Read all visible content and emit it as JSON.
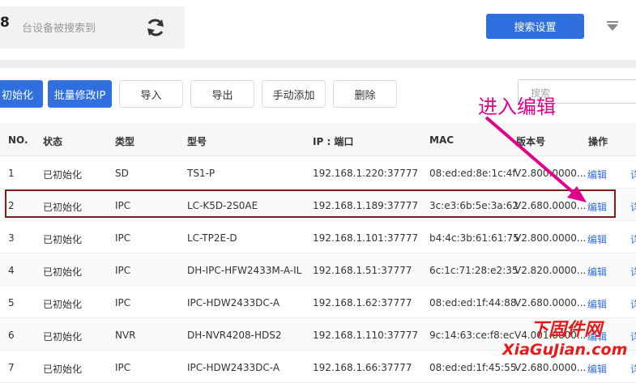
{
  "header": {
    "device_count": "8",
    "device_count_label": "台设备被搜索到",
    "search_settings_label": "搜索设置"
  },
  "toolbar": {
    "init_label": "初始化",
    "batch_modify_ip_label": "批量修改IP",
    "import_label": "导入",
    "export_label": "导出",
    "manual_add_label": "手动添加",
    "delete_label": "删除",
    "search_placeholder": "搜索"
  },
  "table": {
    "columns": [
      "NO.",
      "状态",
      "类型",
      "型号",
      "IP : 端口",
      "MAC",
      "版本号",
      "操作"
    ],
    "edit_label": "编辑",
    "second_action_label": "详",
    "rows": [
      {
        "no": "1",
        "status": "已初始化",
        "type": "SD",
        "model": "TS1-P",
        "ip": "192.168.1.220:37777",
        "mac": "08:ed:ed:8e:1c:4f",
        "version": "V2.800.0000..."
      },
      {
        "no": "2",
        "status": "已初始化",
        "type": "IPC",
        "model": "LC-K5D-2S0AE",
        "ip": "192.168.1.189:37777",
        "mac": "3c:e3:6b:5e:3a:62",
        "version": "V2.680.0000..."
      },
      {
        "no": "3",
        "status": "已初始化",
        "type": "IPC",
        "model": "LC-TP2E-D",
        "ip": "192.168.1.101:37777",
        "mac": "b4:4c:3b:61:61:75",
        "version": "V2.800.0000..."
      },
      {
        "no": "4",
        "status": "已初始化",
        "type": "IPC",
        "model": "DH-IPC-HFW2433M-A-IL",
        "ip": "192.168.1.51:37777",
        "mac": "6c:1c:71:28:e2:35",
        "version": "V2.820.0000..."
      },
      {
        "no": "5",
        "status": "已初始化",
        "type": "IPC",
        "model": "IPC-HDW2433DC-A",
        "ip": "192.168.1.62:37777",
        "mac": "08:ed:ed:1f:44:88",
        "version": "V2.680.0000..."
      },
      {
        "no": "6",
        "status": "已初始化",
        "type": "NVR",
        "model": "DH-NVR4208-HDS2",
        "ip": "192.168.1.110:37777",
        "mac": "9c:14:63:ce:f8:ec",
        "version": "V4.001.0000..."
      },
      {
        "no": "7",
        "status": "已初始化",
        "type": "IPC",
        "model": "IPC-HDW2433DC-A",
        "ip": "192.168.1.66:37777",
        "mac": "08:ed:ed:1f:45:55",
        "version": "V2.680.0000..."
      }
    ]
  },
  "annotation": {
    "text": "进入编辑",
    "color": "#e0008a"
  },
  "watermark": {
    "cn": "下固件网",
    "en": "XiaGuJian.com"
  },
  "colors": {
    "accent": "#2f6fe0",
    "highlight_border": "#7a1f1f"
  }
}
